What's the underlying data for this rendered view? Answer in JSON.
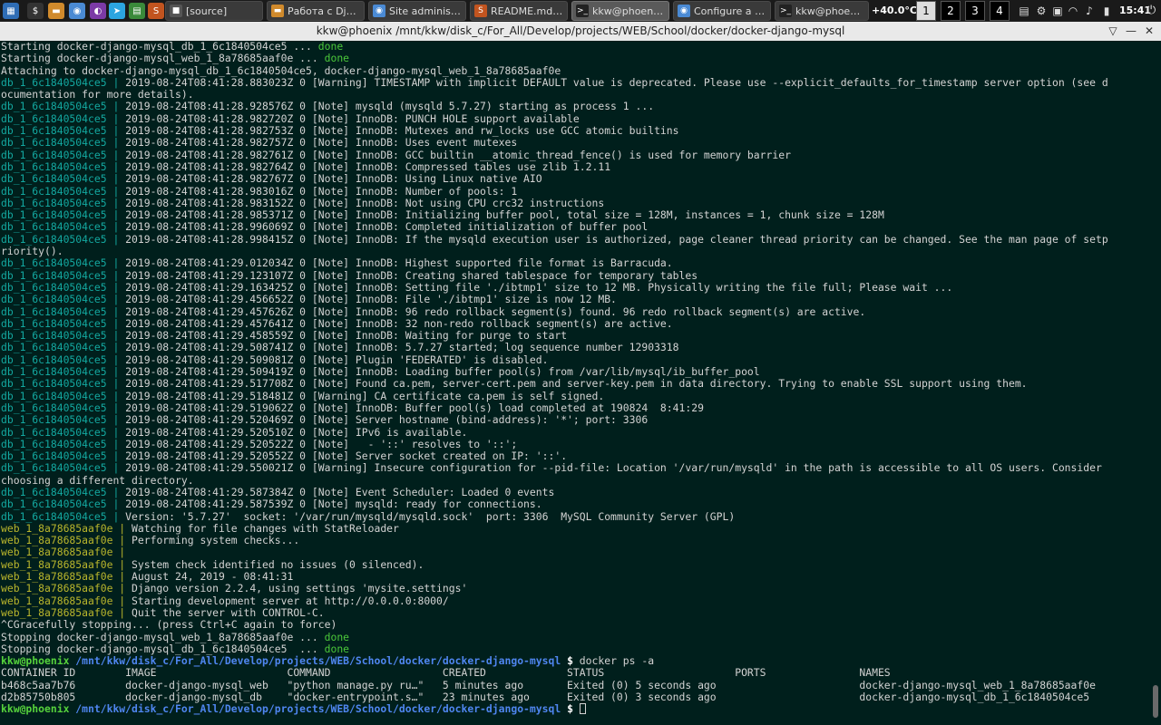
{
  "taskbar": {
    "launchers": [
      {
        "name": "menu-icon",
        "glyph": "▦",
        "color": "#2f6db5"
      },
      {
        "name": "terminal-icon",
        "glyph": "$",
        "color": "#333"
      },
      {
        "name": "folder-icon",
        "glyph": "▬",
        "color": "#d08a2c"
      },
      {
        "name": "chrome-icon",
        "glyph": "◉",
        "color": "#4a8ad4"
      },
      {
        "name": "tor-icon",
        "glyph": "◐",
        "color": "#7c3aa6"
      },
      {
        "name": "telegram-icon",
        "glyph": "➤",
        "color": "#2ca5e0"
      },
      {
        "name": "system-monitor-icon",
        "glyph": "▤",
        "color": "#3a8a3a"
      },
      {
        "name": "sublime-icon",
        "glyph": "S",
        "color": "#c2541f"
      }
    ],
    "tasks": [
      {
        "label": "[source]",
        "icon": "■",
        "color": "#555"
      },
      {
        "label": "Работа с Dja...",
        "icon": "▬",
        "color": "#d08a2c"
      },
      {
        "label": "Site administr...",
        "icon": "◉",
        "color": "#4a8ad4"
      },
      {
        "label": "README.md (...",
        "icon": "S",
        "color": "#c2541f"
      },
      {
        "label": "kkw@phoenix...",
        "icon": ">_",
        "color": "#222"
      },
      {
        "label": "Configure a r...",
        "icon": "◉",
        "color": "#4a8ad4"
      },
      {
        "label": "kkw@phoenix ~",
        "icon": ">_",
        "color": "#222"
      }
    ],
    "temperature": "+40.0°C",
    "desktops": [
      "1",
      "2",
      "3",
      "4"
    ],
    "current_desktop": "1",
    "tray_icons": [
      "flag-us-icon",
      "gear-icon",
      "lock-icon",
      "wifi-icon",
      "volume-icon",
      "battery-icon"
    ],
    "clock": "15:41",
    "power_glyph": "⏻"
  },
  "window": {
    "title": "kkw@phoenix /mnt/kkw/disk_c/For_All/Develop/projects/WEB/School/docker/docker-django-mysql",
    "pin_glyph": "▽",
    "minimize_glyph": "—",
    "close_glyph": "✕"
  },
  "terminal": {
    "lines": [
      [
        [
          "",
          "Starting docker-django-mysql_db_1_6c1840504ce5 ... "
        ],
        [
          "done",
          "done"
        ]
      ],
      [
        [
          "",
          "Starting docker-django-mysql_web_1_8a78685aaf0e ... "
        ],
        [
          "done",
          "done"
        ]
      ],
      [
        [
          "",
          "Attaching to docker-django-mysql_db_1_6c1840504ce5, docker-django-mysql_web_1_8a78685aaf0e"
        ]
      ],
      [
        [
          "db",
          "db_1_6c1840504ce5 | "
        ],
        [
          "",
          "2019-08-24T08:41:28.883023Z 0 [Warning] TIMESTAMP with implicit DEFAULT value is deprecated. Please use --explicit_defaults_for_timestamp server option (see d"
        ]
      ],
      [
        [
          "",
          "ocumentation for more details)."
        ]
      ],
      [
        [
          "db",
          "db_1_6c1840504ce5 | "
        ],
        [
          "",
          "2019-08-24T08:41:28.928576Z 0 [Note] mysqld (mysqld 5.7.27) starting as process 1 ..."
        ]
      ],
      [
        [
          "db",
          "db_1_6c1840504ce5 | "
        ],
        [
          "",
          "2019-08-24T08:41:28.982720Z 0 [Note] InnoDB: PUNCH HOLE support available"
        ]
      ],
      [
        [
          "db",
          "db_1_6c1840504ce5 | "
        ],
        [
          "",
          "2019-08-24T08:41:28.982753Z 0 [Note] InnoDB: Mutexes and rw_locks use GCC atomic builtins"
        ]
      ],
      [
        [
          "db",
          "db_1_6c1840504ce5 | "
        ],
        [
          "",
          "2019-08-24T08:41:28.982757Z 0 [Note] InnoDB: Uses event mutexes"
        ]
      ],
      [
        [
          "db",
          "db_1_6c1840504ce5 | "
        ],
        [
          "",
          "2019-08-24T08:41:28.982761Z 0 [Note] InnoDB: GCC builtin __atomic_thread_fence() is used for memory barrier"
        ]
      ],
      [
        [
          "db",
          "db_1_6c1840504ce5 | "
        ],
        [
          "",
          "2019-08-24T08:41:28.982764Z 0 [Note] InnoDB: Compressed tables use zlib 1.2.11"
        ]
      ],
      [
        [
          "db",
          "db_1_6c1840504ce5 | "
        ],
        [
          "",
          "2019-08-24T08:41:28.982767Z 0 [Note] InnoDB: Using Linux native AIO"
        ]
      ],
      [
        [
          "db",
          "db_1_6c1840504ce5 | "
        ],
        [
          "",
          "2019-08-24T08:41:28.983016Z 0 [Note] InnoDB: Number of pools: 1"
        ]
      ],
      [
        [
          "db",
          "db_1_6c1840504ce5 | "
        ],
        [
          "",
          "2019-08-24T08:41:28.983152Z 0 [Note] InnoDB: Not using CPU crc32 instructions"
        ]
      ],
      [
        [
          "db",
          "db_1_6c1840504ce5 | "
        ],
        [
          "",
          "2019-08-24T08:41:28.985371Z 0 [Note] InnoDB: Initializing buffer pool, total size = 128M, instances = 1, chunk size = 128M"
        ]
      ],
      [
        [
          "db",
          "db_1_6c1840504ce5 | "
        ],
        [
          "",
          "2019-08-24T08:41:28.996069Z 0 [Note] InnoDB: Completed initialization of buffer pool"
        ]
      ],
      [
        [
          "db",
          "db_1_6c1840504ce5 | "
        ],
        [
          "",
          "2019-08-24T08:41:28.998415Z 0 [Note] InnoDB: If the mysqld execution user is authorized, page cleaner thread priority can be changed. See the man page of setp"
        ]
      ],
      [
        [
          "",
          "riority()."
        ]
      ],
      [
        [
          "db",
          "db_1_6c1840504ce5 | "
        ],
        [
          "",
          "2019-08-24T08:41:29.012034Z 0 [Note] InnoDB: Highest supported file format is Barracuda."
        ]
      ],
      [
        [
          "db",
          "db_1_6c1840504ce5 | "
        ],
        [
          "",
          "2019-08-24T08:41:29.123107Z 0 [Note] InnoDB: Creating shared tablespace for temporary tables"
        ]
      ],
      [
        [
          "db",
          "db_1_6c1840504ce5 | "
        ],
        [
          "",
          "2019-08-24T08:41:29.163425Z 0 [Note] InnoDB: Setting file './ibtmp1' size to 12 MB. Physically writing the file full; Please wait ..."
        ]
      ],
      [
        [
          "db",
          "db_1_6c1840504ce5 | "
        ],
        [
          "",
          "2019-08-24T08:41:29.456652Z 0 [Note] InnoDB: File './ibtmp1' size is now 12 MB."
        ]
      ],
      [
        [
          "db",
          "db_1_6c1840504ce5 | "
        ],
        [
          "",
          "2019-08-24T08:41:29.457626Z 0 [Note] InnoDB: 96 redo rollback segment(s) found. 96 redo rollback segment(s) are active."
        ]
      ],
      [
        [
          "db",
          "db_1_6c1840504ce5 | "
        ],
        [
          "",
          "2019-08-24T08:41:29.457641Z 0 [Note] InnoDB: 32 non-redo rollback segment(s) are active."
        ]
      ],
      [
        [
          "db",
          "db_1_6c1840504ce5 | "
        ],
        [
          "",
          "2019-08-24T08:41:29.458559Z 0 [Note] InnoDB: Waiting for purge to start"
        ]
      ],
      [
        [
          "db",
          "db_1_6c1840504ce5 | "
        ],
        [
          "",
          "2019-08-24T08:41:29.508741Z 0 [Note] InnoDB: 5.7.27 started; log sequence number 12903318"
        ]
      ],
      [
        [
          "db",
          "db_1_6c1840504ce5 | "
        ],
        [
          "",
          "2019-08-24T08:41:29.509081Z 0 [Note] Plugin 'FEDERATED' is disabled."
        ]
      ],
      [
        [
          "db",
          "db_1_6c1840504ce5 | "
        ],
        [
          "",
          "2019-08-24T08:41:29.509419Z 0 [Note] InnoDB: Loading buffer pool(s) from /var/lib/mysql/ib_buffer_pool"
        ]
      ],
      [
        [
          "db",
          "db_1_6c1840504ce5 | "
        ],
        [
          "",
          "2019-08-24T08:41:29.517708Z 0 [Note] Found ca.pem, server-cert.pem and server-key.pem in data directory. Trying to enable SSL support using them."
        ]
      ],
      [
        [
          "db",
          "db_1_6c1840504ce5 | "
        ],
        [
          "",
          "2019-08-24T08:41:29.518481Z 0 [Warning] CA certificate ca.pem is self signed."
        ]
      ],
      [
        [
          "db",
          "db_1_6c1840504ce5 | "
        ],
        [
          "",
          "2019-08-24T08:41:29.519062Z 0 [Note] InnoDB: Buffer pool(s) load completed at 190824  8:41:29"
        ]
      ],
      [
        [
          "db",
          "db_1_6c1840504ce5 | "
        ],
        [
          "",
          "2019-08-24T08:41:29.520469Z 0 [Note] Server hostname (bind-address): '*'; port: 3306"
        ]
      ],
      [
        [
          "db",
          "db_1_6c1840504ce5 | "
        ],
        [
          "",
          "2019-08-24T08:41:29.520510Z 0 [Note] IPv6 is available."
        ]
      ],
      [
        [
          "db",
          "db_1_6c1840504ce5 | "
        ],
        [
          "",
          "2019-08-24T08:41:29.520522Z 0 [Note]   - '::' resolves to '::';"
        ]
      ],
      [
        [
          "db",
          "db_1_6c1840504ce5 | "
        ],
        [
          "",
          "2019-08-24T08:41:29.520552Z 0 [Note] Server socket created on IP: '::'."
        ]
      ],
      [
        [
          "db",
          "db_1_6c1840504ce5 | "
        ],
        [
          "",
          "2019-08-24T08:41:29.550021Z 0 [Warning] Insecure configuration for --pid-file: Location '/var/run/mysqld' in the path is accessible to all OS users. Consider"
        ]
      ],
      [
        [
          "",
          "choosing a different directory."
        ]
      ],
      [
        [
          "db",
          "db_1_6c1840504ce5 | "
        ],
        [
          "",
          "2019-08-24T08:41:29.587384Z 0 [Note] Event Scheduler: Loaded 0 events"
        ]
      ],
      [
        [
          "db",
          "db_1_6c1840504ce5 | "
        ],
        [
          "",
          "2019-08-24T08:41:29.587539Z 0 [Note] mysqld: ready for connections."
        ]
      ],
      [
        [
          "db",
          "db_1_6c1840504ce5 | "
        ],
        [
          "",
          "Version: '5.7.27'  socket: '/var/run/mysqld/mysqld.sock'  port: 3306  MySQL Community Server (GPL)"
        ]
      ],
      [
        [
          "web",
          "web_1_8a78685aaf0e | "
        ],
        [
          "",
          "Watching for file changes with StatReloader"
        ]
      ],
      [
        [
          "web",
          "web_1_8a78685aaf0e | "
        ],
        [
          "",
          "Performing system checks..."
        ]
      ],
      [
        [
          "web",
          "web_1_8a78685aaf0e | "
        ]
      ],
      [
        [
          "web",
          "web_1_8a78685aaf0e | "
        ],
        [
          "",
          "System check identified no issues (0 silenced)."
        ]
      ],
      [
        [
          "web",
          "web_1_8a78685aaf0e | "
        ],
        [
          "",
          "August 24, 2019 - 08:41:31"
        ]
      ],
      [
        [
          "web",
          "web_1_8a78685aaf0e | "
        ],
        [
          "",
          "Django version 2.2.4, using settings 'mysite.settings'"
        ]
      ],
      [
        [
          "web",
          "web_1_8a78685aaf0e | "
        ],
        [
          "",
          "Starting development server at http://0.0.0.0:8000/"
        ]
      ],
      [
        [
          "web",
          "web_1_8a78685aaf0e | "
        ],
        [
          "",
          "Quit the server with CONTROL-C."
        ]
      ],
      [
        [
          "",
          "^CGracefully stopping... (press Ctrl+C again to force)"
        ]
      ],
      [
        [
          "",
          "Stopping docker-django-mysql_web_1_8a78685aaf0e ... "
        ],
        [
          "done",
          "done"
        ]
      ],
      [
        [
          "",
          "Stopping docker-django-mysql_db_1_6c1840504ce5  ... "
        ],
        [
          "done",
          "done"
        ]
      ],
      [
        [
          "prompt",
          "kkw@phoenix "
        ],
        [
          "path",
          "/mnt/kkw/disk_c/For_All/Develop/projects/WEB/School/docker/docker-django-mysql "
        ],
        [
          "bold",
          "$ "
        ],
        [
          "",
          "docker ps -a"
        ]
      ],
      [
        [
          "",
          "CONTAINER ID        IMAGE                     COMMAND                  CREATED             STATUS                     PORTS               NAMES"
        ]
      ],
      [
        [
          "",
          "b468c5aa7b76        docker-django-mysql_web   \"python manage.py ru…\"   5 minutes ago       Exited (0) 5 seconds ago                       docker-django-mysql_web_1_8a78685aaf0e"
        ]
      ],
      [
        [
          "",
          "d2b85750b805        docker-django-mysql_db    \"docker-entrypoint.s…\"   23 minutes ago      Exited (0) 3 seconds ago                       docker-django-mysql_db_1_6c1840504ce5"
        ]
      ],
      [
        [
          "prompt",
          "kkw@phoenix "
        ],
        [
          "path",
          "/mnt/kkw/disk_c/For_All/Develop/projects/WEB/School/docker/docker-django-mysql "
        ],
        [
          "bold",
          "$ "
        ],
        [
          "cursor",
          ""
        ]
      ]
    ]
  }
}
